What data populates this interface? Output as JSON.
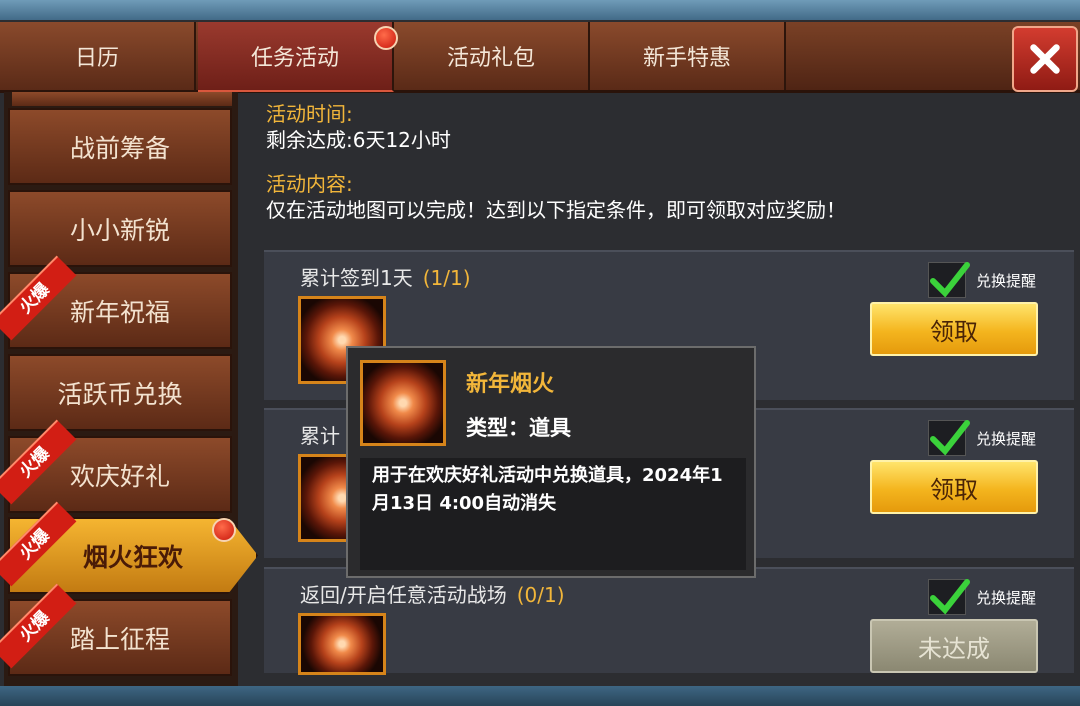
{
  "tabs": [
    {
      "label": "日历",
      "active": false
    },
    {
      "label": "任务活动",
      "active": true,
      "has_notification": true
    },
    {
      "label": "活动礼包",
      "active": false
    },
    {
      "label": "新手特惠",
      "active": false
    }
  ],
  "close_button": {
    "icon": "close-x-icon"
  },
  "sidebar": {
    "items": [
      {
        "label": "战前筹备",
        "hot": false
      },
      {
        "label": "小小新锐",
        "hot": false
      },
      {
        "label": "新年祝福",
        "hot": true,
        "badge": "火爆"
      },
      {
        "label": "活跃币兑换",
        "hot": false
      },
      {
        "label": "欢庆好礼",
        "hot": true,
        "badge": "火爆"
      },
      {
        "label": "烟火狂欢",
        "hot": true,
        "badge": "火爆",
        "active": true,
        "has_notification": true
      },
      {
        "label": "踏上征程",
        "hot": true,
        "badge": "火爆"
      }
    ]
  },
  "activity": {
    "time_label": "活动时间:",
    "time_value": "剩余达成:6天12小时",
    "content_label": "活动内容:",
    "content_value": "仅在活动地图可以完成！达到以下指定条件，即可领取对应奖励！"
  },
  "tasks": [
    {
      "title": "累计签到1天",
      "progress": "(1/1)",
      "reminder_label": "兑换提醒",
      "reminder_checked": true,
      "button": "领取",
      "state": "claimable"
    },
    {
      "title": "累计",
      "progress": "",
      "reminder_label": "兑换提醒",
      "reminder_checked": true,
      "button": "领取",
      "state": "claimable"
    },
    {
      "title": "返回/开启任意活动战场",
      "progress": "(0/1)",
      "reminder_label": "兑换提醒",
      "reminder_checked": true,
      "button": "未达成",
      "state": "incomplete"
    }
  ],
  "tooltip": {
    "name": "新年烟火",
    "type": "类型：道具",
    "description": "用于在欢庆好礼活动中兑换道具，2024年1月13日 4:00自动消失"
  },
  "colors": {
    "accent_gold": "#f2b63a",
    "hot_red": "#d21e14",
    "button_gold": "#f4b51e"
  }
}
